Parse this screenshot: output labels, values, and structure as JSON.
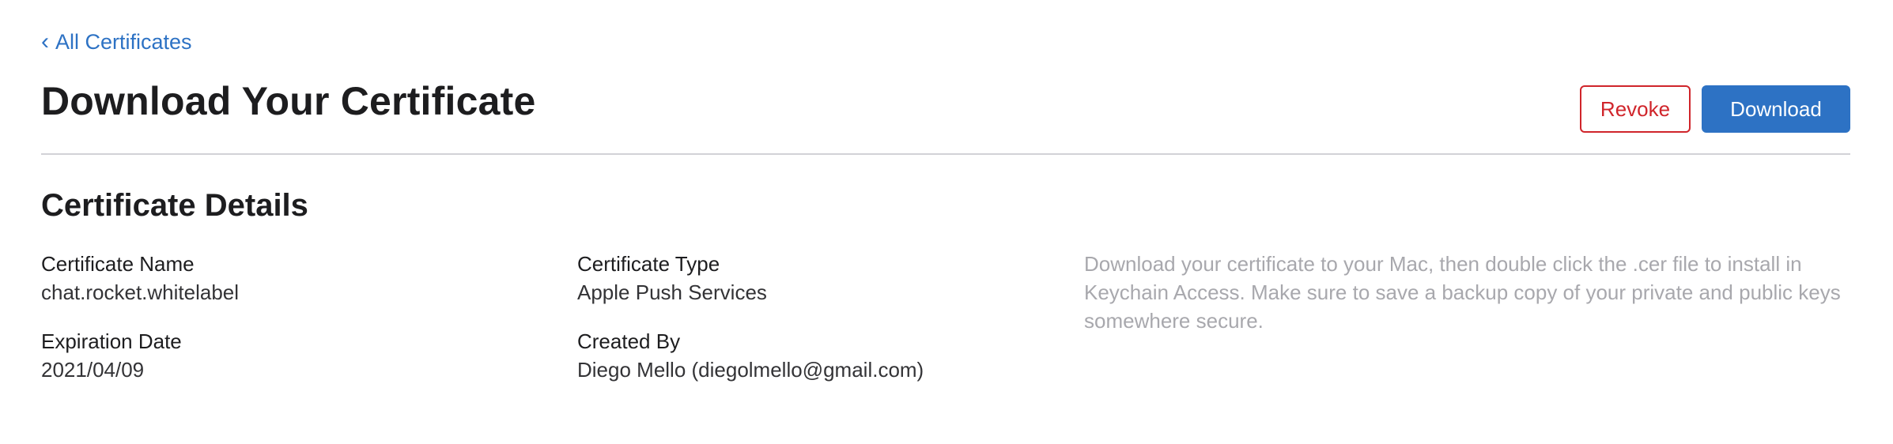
{
  "nav": {
    "back_chevron": "‹",
    "back_label": "All Certificates"
  },
  "header": {
    "title": "Download Your Certificate",
    "revoke_label": "Revoke",
    "download_label": "Download"
  },
  "details": {
    "section_title": "Certificate Details",
    "certificate_name_label": "Certificate Name",
    "certificate_name_value": "chat.rocket.whitelabel",
    "expiration_date_label": "Expiration Date",
    "expiration_date_value": "2021/04/09",
    "certificate_type_label": "Certificate Type",
    "certificate_type_value": "Apple Push Services",
    "created_by_label": "Created By",
    "created_by_value": "Diego Mello (diegolmello@gmail.com)",
    "help_text": "Download your certificate to your Mac, then double click the .cer file to install in Keychain Access. Make sure to save a backup copy of your private and public keys somewhere secure."
  },
  "colors": {
    "link_blue": "#2d72c4",
    "revoke_red": "#d0252b",
    "help_gray": "#a8a8ad",
    "divider": "#d2d2d7"
  }
}
